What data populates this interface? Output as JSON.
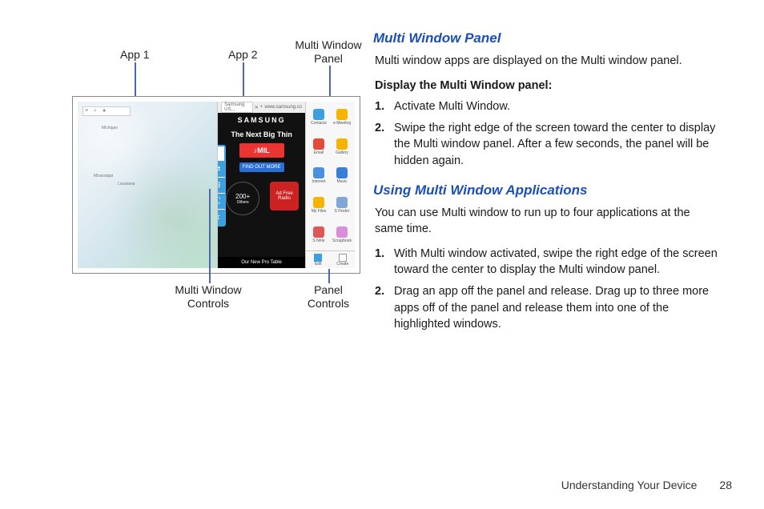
{
  "callouts": {
    "app1": "App 1",
    "app2": "App 2",
    "mwpanel_l1": "Multi Window",
    "mwpanel_l2": "Panel",
    "mwcontrols_l1": "Multi Window",
    "mwcontrols_l2": "Controls",
    "panelctl_l1": "Panel",
    "panelctl_l2": "Controls"
  },
  "device": {
    "addr_tab": "Samsung US...",
    "addr_url": "www.samsung.co",
    "samsung": "SAMSUNG",
    "tagline": "The Next Big Thin",
    "mil": "MIL",
    "find_more": "FIND OUT MORE",
    "count200": "200+",
    "count_sub": "Others",
    "radio": "Ad Free Radio",
    "bottom": "Our New Pro Table",
    "apps": [
      {
        "label": "Contacts",
        "color": "#3ca0e0"
      },
      {
        "label": "e-Meeting",
        "color": "#f5b400"
      },
      {
        "label": "Email",
        "color": "#e34a3a"
      },
      {
        "label": "Gallery",
        "color": "#f5b400"
      },
      {
        "label": "Internet",
        "color": "#4a90e2"
      },
      {
        "label": "Music",
        "color": "#3a7fd6"
      },
      {
        "label": "My Files",
        "color": "#f5b400"
      },
      {
        "label": "S Finder",
        "color": "#7fa8d8"
      },
      {
        "label": "S Note",
        "color": "#e05555"
      },
      {
        "label": "Scrapbook",
        "color": "#d88fd8"
      }
    ],
    "panel_edit": "Edit",
    "panel_create": "Create"
  },
  "text": {
    "h2a": "Multi Window Panel",
    "p1": "Multi window apps are displayed on the Multi window panel.",
    "bold1": "Display the Multi Window panel:",
    "s1_1": "1.",
    "s1_1t": "Activate Multi Window.",
    "s1_2": "2.",
    "s1_2t": "Swipe the right edge of the screen toward the center to display the Multi window panel. After a few seconds, the panel will be hidden again.",
    "h2b": "Using Multi Window Applications",
    "p2": "You can use Multi window to run up to four applications at the same time.",
    "s2_1": "1.",
    "s2_1t": "With Multi window activated, swipe the right edge of the screen toward the center to display the Multi window panel.",
    "s2_2": "2.",
    "s2_2t": "Drag an app off the panel and release. Drag up to three more apps off of the panel and release them into one of the highlighted windows."
  },
  "footer": {
    "section": "Understanding Your Device",
    "page": "28"
  }
}
